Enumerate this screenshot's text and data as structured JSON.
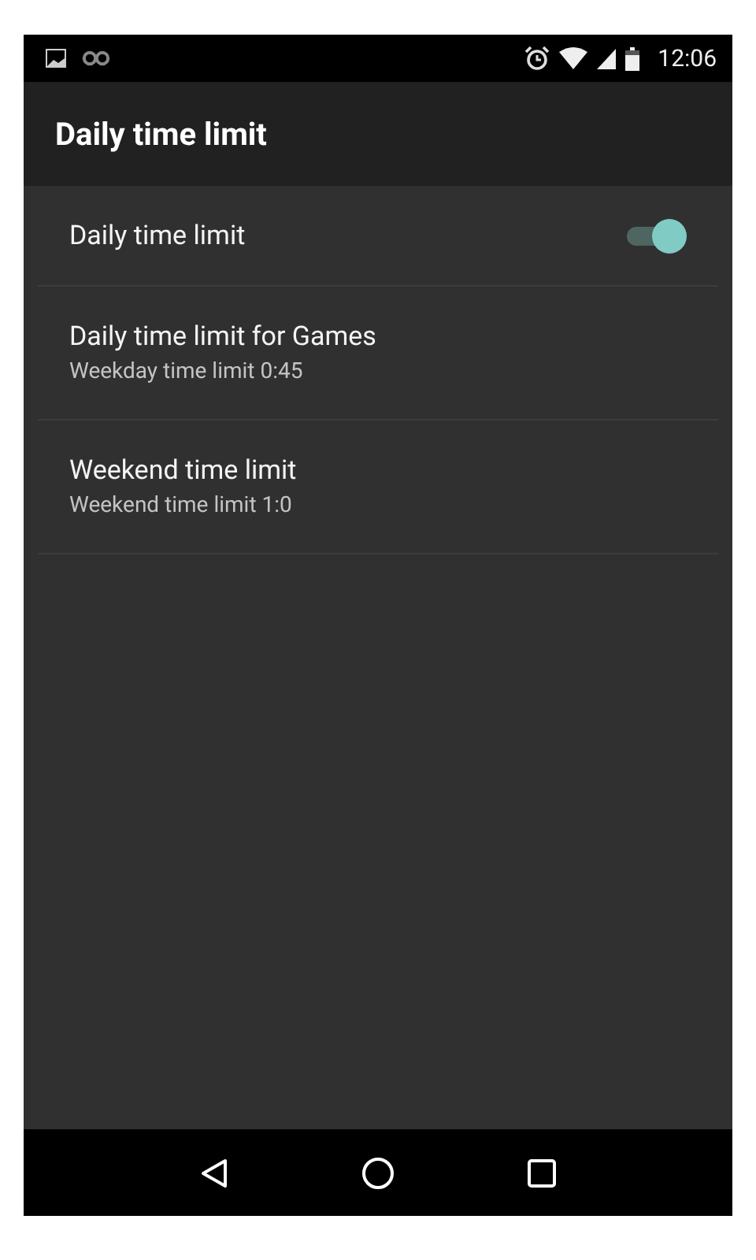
{
  "status_bar": {
    "time": "12:06"
  },
  "app_bar": {
    "title": "Daily time limit"
  },
  "settings": [
    {
      "kind": "switch",
      "title": "Daily time limit",
      "on": true
    },
    {
      "kind": "text",
      "title": "Daily time limit for Games",
      "summary": "Weekday time limit 0:45"
    },
    {
      "kind": "text",
      "title": "Weekend time limit",
      "summary": "Weekend time limit 1:0"
    }
  ]
}
